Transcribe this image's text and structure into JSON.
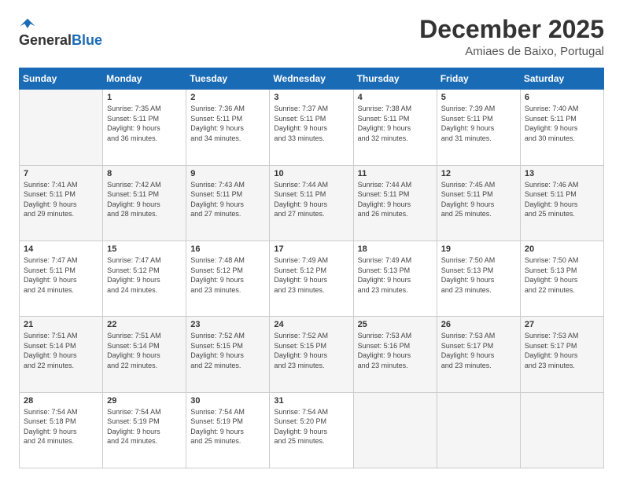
{
  "header": {
    "logo_general": "General",
    "logo_blue": "Blue",
    "title": "December 2025",
    "location": "Amiaes de Baixo, Portugal"
  },
  "calendar": {
    "days_of_week": [
      "Sunday",
      "Monday",
      "Tuesday",
      "Wednesday",
      "Thursday",
      "Friday",
      "Saturday"
    ],
    "weeks": [
      [
        {
          "day": "",
          "info": ""
        },
        {
          "day": "1",
          "info": "Sunrise: 7:35 AM\nSunset: 5:11 PM\nDaylight: 9 hours\nand 36 minutes."
        },
        {
          "day": "2",
          "info": "Sunrise: 7:36 AM\nSunset: 5:11 PM\nDaylight: 9 hours\nand 34 minutes."
        },
        {
          "day": "3",
          "info": "Sunrise: 7:37 AM\nSunset: 5:11 PM\nDaylight: 9 hours\nand 33 minutes."
        },
        {
          "day": "4",
          "info": "Sunrise: 7:38 AM\nSunset: 5:11 PM\nDaylight: 9 hours\nand 32 minutes."
        },
        {
          "day": "5",
          "info": "Sunrise: 7:39 AM\nSunset: 5:11 PM\nDaylight: 9 hours\nand 31 minutes."
        },
        {
          "day": "6",
          "info": "Sunrise: 7:40 AM\nSunset: 5:11 PM\nDaylight: 9 hours\nand 30 minutes."
        }
      ],
      [
        {
          "day": "7",
          "info": "Sunrise: 7:41 AM\nSunset: 5:11 PM\nDaylight: 9 hours\nand 29 minutes."
        },
        {
          "day": "8",
          "info": "Sunrise: 7:42 AM\nSunset: 5:11 PM\nDaylight: 9 hours\nand 28 minutes."
        },
        {
          "day": "9",
          "info": "Sunrise: 7:43 AM\nSunset: 5:11 PM\nDaylight: 9 hours\nand 27 minutes."
        },
        {
          "day": "10",
          "info": "Sunrise: 7:44 AM\nSunset: 5:11 PM\nDaylight: 9 hours\nand 27 minutes."
        },
        {
          "day": "11",
          "info": "Sunrise: 7:44 AM\nSunset: 5:11 PM\nDaylight: 9 hours\nand 26 minutes."
        },
        {
          "day": "12",
          "info": "Sunrise: 7:45 AM\nSunset: 5:11 PM\nDaylight: 9 hours\nand 25 minutes."
        },
        {
          "day": "13",
          "info": "Sunrise: 7:46 AM\nSunset: 5:11 PM\nDaylight: 9 hours\nand 25 minutes."
        }
      ],
      [
        {
          "day": "14",
          "info": "Sunrise: 7:47 AM\nSunset: 5:11 PM\nDaylight: 9 hours\nand 24 minutes."
        },
        {
          "day": "15",
          "info": "Sunrise: 7:47 AM\nSunset: 5:12 PM\nDaylight: 9 hours\nand 24 minutes."
        },
        {
          "day": "16",
          "info": "Sunrise: 7:48 AM\nSunset: 5:12 PM\nDaylight: 9 hours\nand 23 minutes."
        },
        {
          "day": "17",
          "info": "Sunrise: 7:49 AM\nSunset: 5:12 PM\nDaylight: 9 hours\nand 23 minutes."
        },
        {
          "day": "18",
          "info": "Sunrise: 7:49 AM\nSunset: 5:13 PM\nDaylight: 9 hours\nand 23 minutes."
        },
        {
          "day": "19",
          "info": "Sunrise: 7:50 AM\nSunset: 5:13 PM\nDaylight: 9 hours\nand 23 minutes."
        },
        {
          "day": "20",
          "info": "Sunrise: 7:50 AM\nSunset: 5:13 PM\nDaylight: 9 hours\nand 22 minutes."
        }
      ],
      [
        {
          "day": "21",
          "info": "Sunrise: 7:51 AM\nSunset: 5:14 PM\nDaylight: 9 hours\nand 22 minutes."
        },
        {
          "day": "22",
          "info": "Sunrise: 7:51 AM\nSunset: 5:14 PM\nDaylight: 9 hours\nand 22 minutes."
        },
        {
          "day": "23",
          "info": "Sunrise: 7:52 AM\nSunset: 5:15 PM\nDaylight: 9 hours\nand 22 minutes."
        },
        {
          "day": "24",
          "info": "Sunrise: 7:52 AM\nSunset: 5:15 PM\nDaylight: 9 hours\nand 23 minutes."
        },
        {
          "day": "25",
          "info": "Sunrise: 7:53 AM\nSunset: 5:16 PM\nDaylight: 9 hours\nand 23 minutes."
        },
        {
          "day": "26",
          "info": "Sunrise: 7:53 AM\nSunset: 5:17 PM\nDaylight: 9 hours\nand 23 minutes."
        },
        {
          "day": "27",
          "info": "Sunrise: 7:53 AM\nSunset: 5:17 PM\nDaylight: 9 hours\nand 23 minutes."
        }
      ],
      [
        {
          "day": "28",
          "info": "Sunrise: 7:54 AM\nSunset: 5:18 PM\nDaylight: 9 hours\nand 24 minutes."
        },
        {
          "day": "29",
          "info": "Sunrise: 7:54 AM\nSunset: 5:19 PM\nDaylight: 9 hours\nand 24 minutes."
        },
        {
          "day": "30",
          "info": "Sunrise: 7:54 AM\nSunset: 5:19 PM\nDaylight: 9 hours\nand 25 minutes."
        },
        {
          "day": "31",
          "info": "Sunrise: 7:54 AM\nSunset: 5:20 PM\nDaylight: 9 hours\nand 25 minutes."
        },
        {
          "day": "",
          "info": ""
        },
        {
          "day": "",
          "info": ""
        },
        {
          "day": "",
          "info": ""
        }
      ]
    ]
  }
}
